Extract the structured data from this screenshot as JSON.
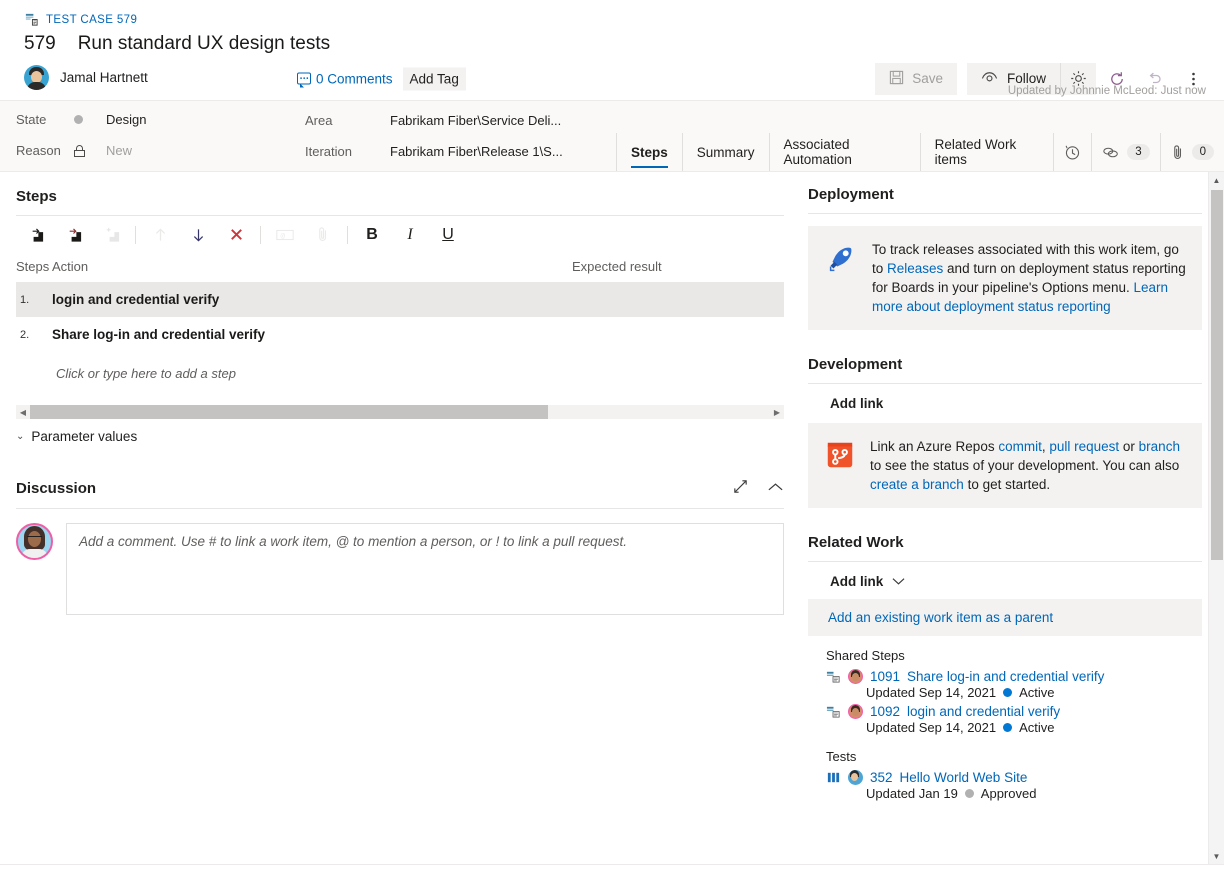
{
  "accent_color": "#0f5c62",
  "link_color": "#0067b8",
  "header": {
    "breadcrumb": "TEST CASE 579",
    "breadcrumb_icon": "test-case-icon",
    "work_item_id": "579",
    "title": "Run standard UX design tests",
    "author": "Jamal Hartnett",
    "comments_label": "0 Comments",
    "add_tag_label": "Add Tag",
    "save_label": "Save",
    "follow_label": "Follow",
    "gear_icon": "gear-icon",
    "refresh_icon": "refresh-icon",
    "undo_icon": "undo-icon",
    "more_icon": "more-actions-icon",
    "updated_note": "Updated by Johnnie McLeod: Just now"
  },
  "fields": {
    "state_label": "State",
    "state_value": "Design",
    "reason_label": "Reason",
    "reason_value": "New",
    "area_label": "Area",
    "area_value": "Fabrikam Fiber\\Service Deli...",
    "iteration_label": "Iteration",
    "iteration_value": "Fabrikam Fiber\\Release 1\\S..."
  },
  "tabs": [
    {
      "label": "Steps",
      "active": true
    },
    {
      "label": "Summary",
      "active": false
    },
    {
      "label": "Associated Automation",
      "active": false
    },
    {
      "label": "Related Work items",
      "active": false
    }
  ],
  "tab_icons": [
    {
      "name": "history-icon",
      "count": null
    },
    {
      "name": "links-icon",
      "count": "3"
    },
    {
      "name": "attachments-icon",
      "count": "0"
    }
  ],
  "steps_panel": {
    "title": "Steps",
    "toolbar": [
      {
        "name": "insert-step-icon",
        "disabled": false
      },
      {
        "name": "insert-shared-step-icon",
        "disabled": false
      },
      {
        "name": "add-step-icon",
        "disabled": true
      },
      {
        "name": "move-up-icon",
        "disabled": true
      },
      {
        "name": "move-down-icon",
        "disabled": false
      },
      {
        "name": "delete-step-icon",
        "disabled": false
      },
      {
        "name": "insert-parameter-icon",
        "disabled": true
      },
      {
        "name": "attach-file-icon",
        "disabled": true
      },
      {
        "name": "bold-icon",
        "label": "B",
        "disabled": false
      },
      {
        "name": "italic-icon",
        "label": "I",
        "disabled": false
      },
      {
        "name": "underline-icon",
        "label": "U",
        "disabled": false
      }
    ],
    "columns": {
      "steps": "Steps",
      "action": "Action",
      "expected": "Expected result"
    },
    "rows": [
      {
        "num": "1.",
        "action": "login and credential verify",
        "expected": "",
        "selected": true
      },
      {
        "num": "2.",
        "action": "Share log-in and credential verify",
        "expected": "",
        "selected": false
      }
    ],
    "add_step_placeholder": "Click or type here to add a step",
    "parameter_values_label": "Parameter values"
  },
  "discussion": {
    "title": "Discussion",
    "expand_icon": "expand-icon",
    "collapse_icon": "chevron-up-icon",
    "comment_placeholder": "Add a comment. Use # to link a work item, @ to mention a person, or ! to link a pull request."
  },
  "deployment": {
    "title": "Deployment",
    "icon": "rocket-icon",
    "text_1": "To track releases associated with this work item, go to ",
    "link_1": "Releases",
    "text_2": " and turn on deployment status reporting for Boards in your pipeline's Options menu. ",
    "link_2": "Learn more about deployment status reporting"
  },
  "development": {
    "title": "Development",
    "add_link_label": "Add link",
    "icon": "repos-branch-icon",
    "text_1": "Link an Azure Repos ",
    "link_1": "commit",
    "sep_1": ", ",
    "link_2": "pull request",
    "text_2": " or ",
    "link_3": "branch",
    "text_3": " to see the status of your development. You can also ",
    "link_4": "create a branch",
    "text_4": " to get started."
  },
  "related_work": {
    "title": "Related Work",
    "add_link_label": "Add link",
    "add_link_chevron": "chevron-down-icon",
    "add_parent_label": "Add an existing work item as a parent",
    "groups": [
      {
        "title": "Shared Steps",
        "items": [
          {
            "icon": "shared-steps-icon",
            "avatar": "user-avatar",
            "id": "1091",
            "title": "Share log-in and credential verify",
            "updated": "Updated Sep 14, 2021",
            "state": "Active",
            "state_color": "#0078d4"
          },
          {
            "icon": "shared-steps-icon",
            "avatar": "user-avatar",
            "id": "1092",
            "title": "login and credential verify",
            "updated": "Updated Sep 14, 2021",
            "state": "Active",
            "state_color": "#0078d4"
          }
        ]
      },
      {
        "title": "Tests",
        "items": [
          {
            "icon": "test-suite-icon",
            "avatar": "user-avatar",
            "id": "352",
            "title": "Hello World Web Site",
            "updated": "Updated Jan 19",
            "state": "Approved",
            "state_color": "#b1b1b1"
          }
        ]
      }
    ]
  }
}
